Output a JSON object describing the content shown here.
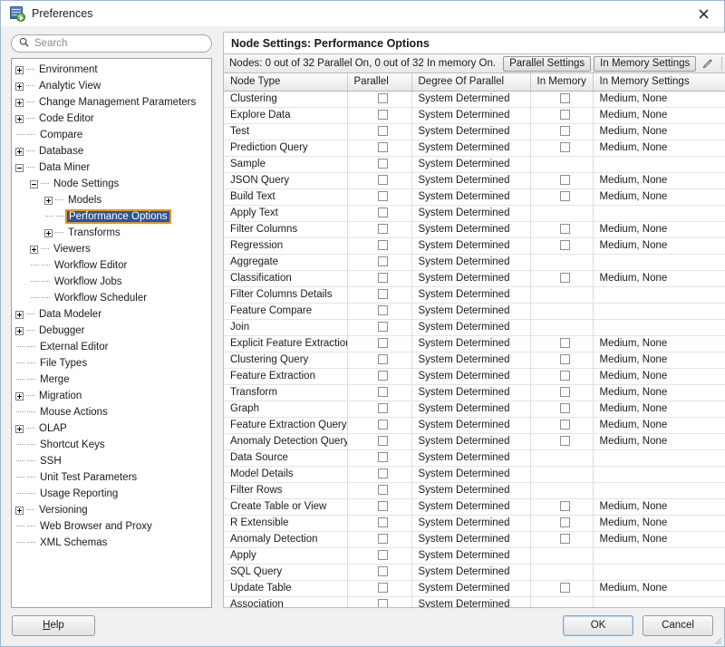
{
  "window": {
    "title": "Preferences",
    "icon": "preferences-app-icon",
    "close_label": "✕"
  },
  "search": {
    "placeholder": "Search",
    "value": "",
    "icon": "search-icon"
  },
  "tree": [
    {
      "label": "Environment",
      "depth": 0,
      "toggle": "plus"
    },
    {
      "label": "Analytic View",
      "depth": 0,
      "toggle": "plus"
    },
    {
      "label": "Change Management Parameters",
      "depth": 0,
      "toggle": "plus"
    },
    {
      "label": "Code Editor",
      "depth": 0,
      "toggle": "plus"
    },
    {
      "label": "Compare",
      "depth": 0,
      "toggle": "none"
    },
    {
      "label": "Database",
      "depth": 0,
      "toggle": "plus"
    },
    {
      "label": "Data Miner",
      "depth": 0,
      "toggle": "minus"
    },
    {
      "label": "Node Settings",
      "depth": 1,
      "toggle": "minus"
    },
    {
      "label": "Models",
      "depth": 2,
      "toggle": "plus"
    },
    {
      "label": "Performance Options",
      "depth": 2,
      "toggle": "none",
      "selected": true
    },
    {
      "label": "Transforms",
      "depth": 2,
      "toggle": "plus"
    },
    {
      "label": "Viewers",
      "depth": 1,
      "toggle": "plus"
    },
    {
      "label": "Workflow Editor",
      "depth": 1,
      "toggle": "none"
    },
    {
      "label": "Workflow Jobs",
      "depth": 1,
      "toggle": "none"
    },
    {
      "label": "Workflow Scheduler",
      "depth": 1,
      "toggle": "none"
    },
    {
      "label": "Data Modeler",
      "depth": 0,
      "toggle": "plus"
    },
    {
      "label": "Debugger",
      "depth": 0,
      "toggle": "plus"
    },
    {
      "label": "External Editor",
      "depth": 0,
      "toggle": "none"
    },
    {
      "label": "File Types",
      "depth": 0,
      "toggle": "none"
    },
    {
      "label": "Merge",
      "depth": 0,
      "toggle": "none"
    },
    {
      "label": "Migration",
      "depth": 0,
      "toggle": "plus"
    },
    {
      "label": "Mouse Actions",
      "depth": 0,
      "toggle": "none"
    },
    {
      "label": "OLAP",
      "depth": 0,
      "toggle": "plus"
    },
    {
      "label": "Shortcut Keys",
      "depth": 0,
      "toggle": "none"
    },
    {
      "label": "SSH",
      "depth": 0,
      "toggle": "none"
    },
    {
      "label": "Unit Test Parameters",
      "depth": 0,
      "toggle": "none"
    },
    {
      "label": "Usage Reporting",
      "depth": 0,
      "toggle": "none"
    },
    {
      "label": "Versioning",
      "depth": 0,
      "toggle": "plus"
    },
    {
      "label": "Web Browser and Proxy",
      "depth": 0,
      "toggle": "none"
    },
    {
      "label": "XML Schemas",
      "depth": 0,
      "toggle": "none"
    }
  ],
  "panel": {
    "title": "Node Settings: Performance Options",
    "toolbar": {
      "status": "Nodes: 0 out of 32 Parallel On, 0 out of 32 In memory On.",
      "parallel_settings_label": "Parallel Settings",
      "in_memory_settings_label": "In Memory Settings",
      "edit_icon": "pencil-edit-icon",
      "overflow_label": "»"
    }
  },
  "table": {
    "columns": [
      "Node Type",
      "Parallel",
      "Degree Of Parallel",
      "In Memory",
      "In Memory Settings"
    ],
    "default_degree": "System Determined",
    "rows": [
      {
        "node_type": "Clustering",
        "parallel": false,
        "degree": "System Determined",
        "in_memory": false,
        "in_memory_settings": "Medium, None"
      },
      {
        "node_type": "Explore Data",
        "parallel": false,
        "degree": "System Determined",
        "in_memory": false,
        "in_memory_settings": "Medium, None"
      },
      {
        "node_type": "Test",
        "parallel": false,
        "degree": "System Determined",
        "in_memory": false,
        "in_memory_settings": "Medium, None"
      },
      {
        "node_type": "Prediction Query",
        "parallel": false,
        "degree": "System Determined",
        "in_memory": false,
        "in_memory_settings": "Medium, None"
      },
      {
        "node_type": "Sample",
        "parallel": false,
        "degree": "System Determined",
        "in_memory": null,
        "in_memory_settings": ""
      },
      {
        "node_type": "JSON Query",
        "parallel": false,
        "degree": "System Determined",
        "in_memory": false,
        "in_memory_settings": "Medium, None"
      },
      {
        "node_type": "Build Text",
        "parallel": false,
        "degree": "System Determined",
        "in_memory": false,
        "in_memory_settings": "Medium, None"
      },
      {
        "node_type": "Apply Text",
        "parallel": false,
        "degree": "System Determined",
        "in_memory": null,
        "in_memory_settings": ""
      },
      {
        "node_type": "Filter Columns",
        "parallel": false,
        "degree": "System Determined",
        "in_memory": false,
        "in_memory_settings": "Medium, None"
      },
      {
        "node_type": "Regression",
        "parallel": false,
        "degree": "System Determined",
        "in_memory": false,
        "in_memory_settings": "Medium, None"
      },
      {
        "node_type": "Aggregate",
        "parallel": false,
        "degree": "System Determined",
        "in_memory": null,
        "in_memory_settings": ""
      },
      {
        "node_type": "Classification",
        "parallel": false,
        "degree": "System Determined",
        "in_memory": false,
        "in_memory_settings": "Medium, None"
      },
      {
        "node_type": "Filter Columns Details",
        "parallel": false,
        "degree": "System Determined",
        "in_memory": null,
        "in_memory_settings": ""
      },
      {
        "node_type": "Feature Compare",
        "parallel": false,
        "degree": "System Determined",
        "in_memory": null,
        "in_memory_settings": ""
      },
      {
        "node_type": "Join",
        "parallel": false,
        "degree": "System Determined",
        "in_memory": null,
        "in_memory_settings": ""
      },
      {
        "node_type": "Explicit Feature Extraction",
        "parallel": false,
        "degree": "System Determined",
        "in_memory": false,
        "in_memory_settings": "Medium, None"
      },
      {
        "node_type": "Clustering Query",
        "parallel": false,
        "degree": "System Determined",
        "in_memory": false,
        "in_memory_settings": "Medium, None"
      },
      {
        "node_type": "Feature Extraction",
        "parallel": false,
        "degree": "System Determined",
        "in_memory": false,
        "in_memory_settings": "Medium, None"
      },
      {
        "node_type": "Transform",
        "parallel": false,
        "degree": "System Determined",
        "in_memory": false,
        "in_memory_settings": "Medium, None"
      },
      {
        "node_type": "Graph",
        "parallel": false,
        "degree": "System Determined",
        "in_memory": false,
        "in_memory_settings": "Medium, None"
      },
      {
        "node_type": "Feature Extraction Query",
        "parallel": false,
        "degree": "System Determined",
        "in_memory": false,
        "in_memory_settings": "Medium, None"
      },
      {
        "node_type": "Anomaly Detection Query",
        "parallel": false,
        "degree": "System Determined",
        "in_memory": false,
        "in_memory_settings": "Medium, None"
      },
      {
        "node_type": "Data Source",
        "parallel": false,
        "degree": "System Determined",
        "in_memory": null,
        "in_memory_settings": ""
      },
      {
        "node_type": "Model Details",
        "parallel": false,
        "degree": "System Determined",
        "in_memory": null,
        "in_memory_settings": ""
      },
      {
        "node_type": "Filter Rows",
        "parallel": false,
        "degree": "System Determined",
        "in_memory": null,
        "in_memory_settings": ""
      },
      {
        "node_type": "Create Table or View",
        "parallel": false,
        "degree": "System Determined",
        "in_memory": false,
        "in_memory_settings": "Medium, None"
      },
      {
        "node_type": "R Extensible",
        "parallel": false,
        "degree": "System Determined",
        "in_memory": false,
        "in_memory_settings": "Medium, None"
      },
      {
        "node_type": "Anomaly Detection",
        "parallel": false,
        "degree": "System Determined",
        "in_memory": false,
        "in_memory_settings": "Medium, None"
      },
      {
        "node_type": "Apply",
        "parallel": false,
        "degree": "System Determined",
        "in_memory": null,
        "in_memory_settings": ""
      },
      {
        "node_type": "SQL Query",
        "parallel": false,
        "degree": "System Determined",
        "in_memory": null,
        "in_memory_settings": ""
      },
      {
        "node_type": "Update Table",
        "parallel": false,
        "degree": "System Determined",
        "in_memory": false,
        "in_memory_settings": "Medium, None"
      },
      {
        "node_type": "Association",
        "parallel": false,
        "degree": "System Determined",
        "in_memory": null,
        "in_memory_settings": ""
      }
    ]
  },
  "footer": {
    "help_label": "Help",
    "help_mnemonic": "H",
    "ok_label": "OK",
    "cancel_label": "Cancel"
  }
}
